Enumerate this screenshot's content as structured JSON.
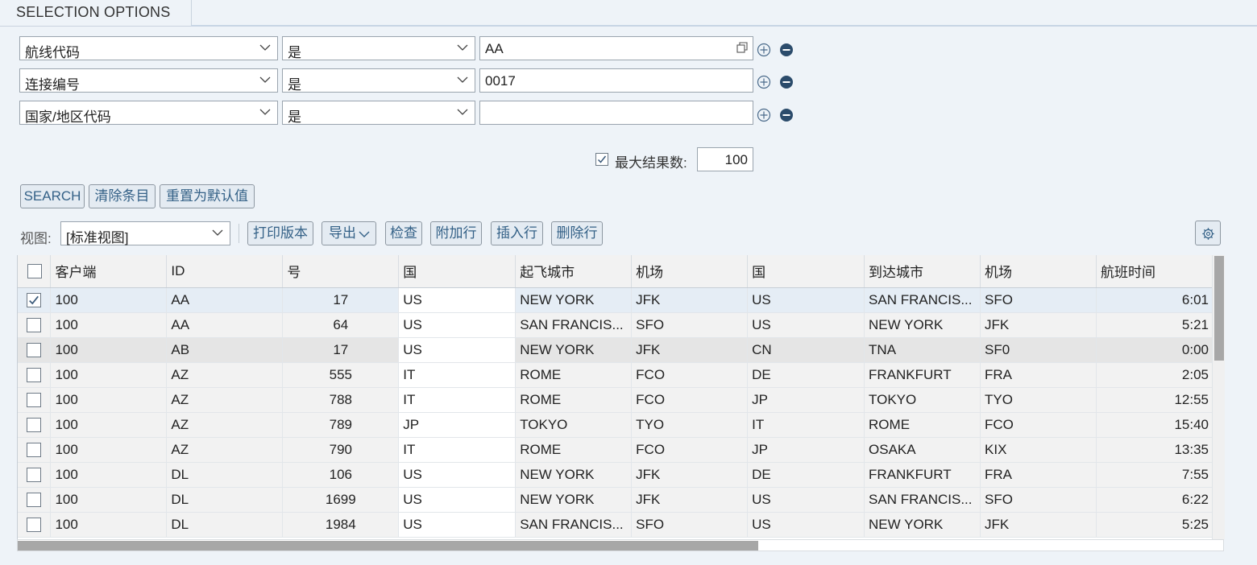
{
  "section_title": "SELECTION OPTIONS",
  "criteria": [
    {
      "field": "航线代码",
      "operator": "是",
      "value": "AA"
    },
    {
      "field": "连接编号",
      "operator": "是",
      "value": "0017"
    },
    {
      "field": "国家/地区代码",
      "operator": "是",
      "value": ""
    }
  ],
  "max_results": {
    "label": "最大结果数:",
    "value": "100",
    "checked": true
  },
  "buttons": {
    "search": "SEARCH",
    "clear": "清除条目",
    "reset": "重置为默认值"
  },
  "toolbar": {
    "view_label": "视图:",
    "view_value": "[标准视图]",
    "print": "打印版本",
    "export": "导出",
    "check": "检查",
    "append_row": "附加行",
    "insert_row": "插入行",
    "delete_row": "删除行"
  },
  "table": {
    "columns": [
      "客户端",
      "ID",
      "号",
      "国",
      "起飞城市",
      "机场",
      "国",
      "到达城市",
      "机场",
      "航班时间"
    ],
    "rows": [
      {
        "selected": true,
        "cells": [
          "100",
          "AA",
          "17",
          "US",
          "NEW YORK",
          "JFK",
          "US",
          "SAN FRANCIS...",
          "SFO",
          "6:01"
        ]
      },
      {
        "selected": false,
        "cells": [
          "100",
          "AA",
          "64",
          "US",
          "SAN FRANCIS...",
          "SFO",
          "US",
          "NEW YORK",
          "JFK",
          "5:21"
        ]
      },
      {
        "selected": false,
        "cells": [
          "100",
          "AB",
          "17",
          "US",
          "NEW YORK",
          "JFK",
          "CN",
          "TNA",
          "SF0",
          "0:00"
        ]
      },
      {
        "selected": false,
        "cells": [
          "100",
          "AZ",
          "555",
          "IT",
          "ROME",
          "FCO",
          "DE",
          "FRANKFURT",
          "FRA",
          "2:05"
        ]
      },
      {
        "selected": false,
        "cells": [
          "100",
          "AZ",
          "788",
          "IT",
          "ROME",
          "FCO",
          "JP",
          "TOKYO",
          "TYO",
          "12:55"
        ]
      },
      {
        "selected": false,
        "cells": [
          "100",
          "AZ",
          "789",
          "JP",
          "TOKYO",
          "TYO",
          "IT",
          "ROME",
          "FCO",
          "15:40"
        ]
      },
      {
        "selected": false,
        "cells": [
          "100",
          "AZ",
          "790",
          "IT",
          "ROME",
          "FCO",
          "JP",
          "OSAKA",
          "KIX",
          "13:35"
        ]
      },
      {
        "selected": false,
        "cells": [
          "100",
          "DL",
          "106",
          "US",
          "NEW YORK",
          "JFK",
          "DE",
          "FRANKFURT",
          "FRA",
          "7:55"
        ]
      },
      {
        "selected": false,
        "cells": [
          "100",
          "DL",
          "1699",
          "US",
          "NEW YORK",
          "JFK",
          "US",
          "SAN FRANCIS...",
          "SFO",
          "6:22"
        ]
      },
      {
        "selected": false,
        "cells": [
          "100",
          "DL",
          "1984",
          "US",
          "SAN FRANCIS...",
          "SFO",
          "US",
          "NEW YORK",
          "JFK",
          "5:25"
        ]
      }
    ]
  },
  "colors": {
    "accent_text": "#346187",
    "button_bg": "#e4ebf2",
    "page_bg": "#eef3f8",
    "scroll_thumb": "#a7a7a7"
  }
}
